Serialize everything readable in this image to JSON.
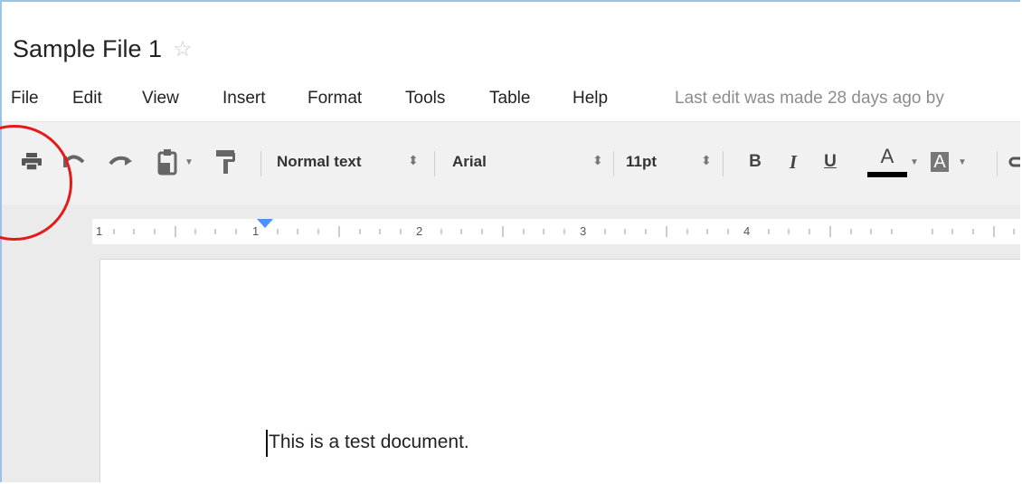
{
  "document": {
    "title": "Sample File 1",
    "star_icon": "star-outline-icon",
    "body_text": "This is a test document."
  },
  "menubar": {
    "items": [
      "File",
      "Edit",
      "View",
      "Insert",
      "Format",
      "Tools",
      "Table",
      "Help"
    ],
    "last_edit": "Last edit was made 28 days ago by"
  },
  "toolbar": {
    "icons": [
      "print-icon",
      "undo-icon",
      "redo-icon",
      "paste-icon",
      "paint-format-icon",
      "bold-icon",
      "italic-icon",
      "underline-icon",
      "text-color-icon",
      "highlight-color-icon",
      "link-icon"
    ],
    "style_select": "Normal text",
    "font_select": "Arial",
    "size_select": "11pt",
    "bold_label": "B",
    "italic_label": "I",
    "underline_label": "U",
    "text_color_label": "A",
    "highlight_label": "A"
  },
  "ruler": {
    "labels": [
      "1",
      "1",
      "2",
      "3",
      "4"
    ]
  },
  "colors": {
    "annotation_circle": "#e31a1a",
    "text_color_bar": "#000000",
    "indent_marker": "#4d90fe"
  }
}
